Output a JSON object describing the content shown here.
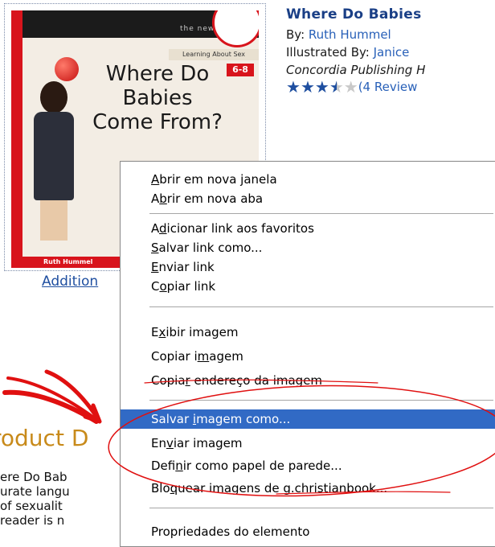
{
  "book": {
    "title": "Where Do Babies",
    "by_label": "By: ",
    "author": "Ruth Hummel",
    "illustrated_label": "Illustrated By: ",
    "illustrator": "Janice",
    "publisher": "Concordia Publishing H",
    "rating": {
      "stars_filled": 3.5,
      "stars_total": 5,
      "reviews_text": "(4 Review"
    },
    "more_images_link": "Addition"
  },
  "cover": {
    "series": "the new",
    "learning": "Learning About Sex",
    "age": "6-8",
    "title_lines": [
      "Where Do",
      "Babies",
      "Come From?"
    ],
    "author": "Ruth Hummel"
  },
  "product": {
    "heading": "roduct D",
    "description_lines": [
      "ere Do Bab",
      "urate langu",
      " of sexualit",
      " reader is n"
    ]
  },
  "context_menu": {
    "items": [
      {
        "label_parts": [
          "",
          "A",
          "brir em nova janela"
        ],
        "highlighted": false
      },
      {
        "label_parts": [
          "A",
          "b",
          "rir em nova aba"
        ],
        "highlighted": false
      },
      {
        "label_parts": [
          "A",
          "d",
          "icionar link aos favoritos"
        ],
        "highlighted": false
      },
      {
        "label_parts": [
          "",
          "S",
          "alvar link como..."
        ],
        "highlighted": false
      },
      {
        "label_parts": [
          "",
          "E",
          "nviar link"
        ],
        "highlighted": false
      },
      {
        "label_parts": [
          "C",
          "o",
          "piar link"
        ],
        "highlighted": false
      },
      {
        "label_parts": [
          "E",
          "x",
          "ibir imagem"
        ],
        "highlighted": false
      },
      {
        "label_parts": [
          "Copiar i",
          "m",
          "agem"
        ],
        "highlighted": false
      },
      {
        "label_parts": [
          "Copia",
          "r",
          " endereço da imagem"
        ],
        "highlighted": false
      },
      {
        "label_parts": [
          "Salvar ",
          "i",
          "magem como..."
        ],
        "highlighted": true
      },
      {
        "label_parts": [
          "En",
          "v",
          "iar imagem"
        ],
        "highlighted": false
      },
      {
        "label_parts": [
          "Defi",
          "n",
          "ir como papel de parede..."
        ],
        "highlighted": false
      },
      {
        "label_parts": [
          "Blo",
          "q",
          "uear imagens de g.christianbook..."
        ],
        "highlighted": false
      },
      {
        "label_parts": [
          "Propriedades do elemento",
          "",
          ""
        ],
        "highlighted": false
      }
    ],
    "highlight_color": "#316ac5"
  },
  "annotation_color": "#e01010"
}
